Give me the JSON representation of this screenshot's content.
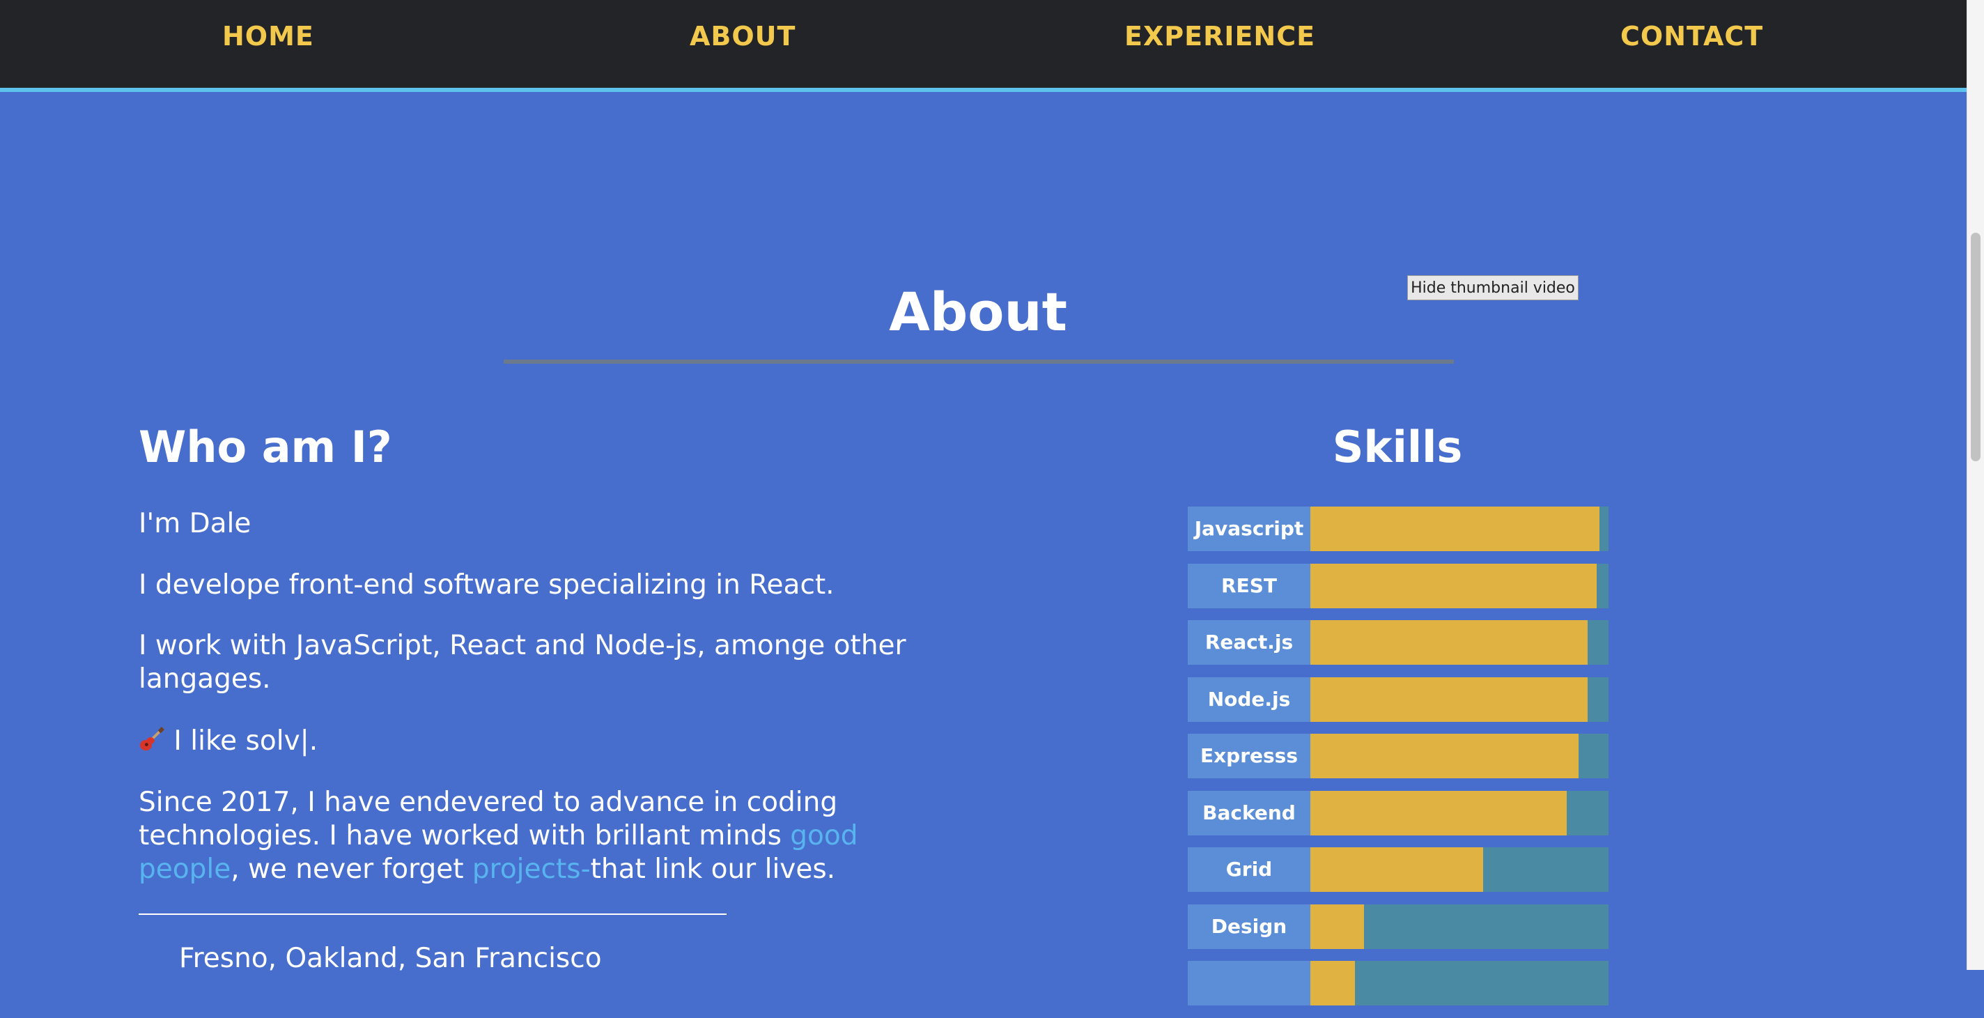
{
  "nav": {
    "home": "HOME",
    "about": "ABOUT",
    "experience": "EXPERIENCE",
    "contact": "CONTACT"
  },
  "tooltip": {
    "hide_thumbnail": "Hide thumbnail video"
  },
  "about": {
    "title": "About",
    "who": {
      "title": "Who am I?",
      "p1": "I'm Dale",
      "p2": "I develope front-end software specializing in React.",
      "p3": "I work with JavaScript, React and Node-js, amonge other langages.",
      "p4_icon": "guitar-icon",
      "p4_text": " I like solv|.",
      "p5_a": "Since 2017, I have endevered to advance in coding technologies. I have worked with brillant minds ",
      "p5_link1": "good people",
      "p5_b": ", we never forget ",
      "p5_link2": "projects-",
      "p5_c": "that link our lives.",
      "cities": "Fresno, Oakland, San Francisco"
    },
    "skills": {
      "title": "Skills",
      "items": [
        {
          "label": "Javascript",
          "level": 0.97
        },
        {
          "label": "REST",
          "level": 0.96
        },
        {
          "label": "React.js",
          "level": 0.93
        },
        {
          "label": "Node.js",
          "level": 0.93
        },
        {
          "label": "Expresss",
          "level": 0.9
        },
        {
          "label": "Backend",
          "level": 0.86
        },
        {
          "label": "Grid",
          "level": 0.58
        },
        {
          "label": "Design",
          "level": 0.18
        },
        {
          "label": "",
          "level": 0.15
        }
      ]
    }
  },
  "colors": {
    "background": "#486ecd",
    "nav_bg": "#232428",
    "nav_text": "#f2c94c",
    "nav_border": "#5ec3ea",
    "skill_fill": "#e0b242",
    "skill_track": "#4a8aa3",
    "skill_label": "#5b8ed6",
    "link": "#58b4ee"
  }
}
